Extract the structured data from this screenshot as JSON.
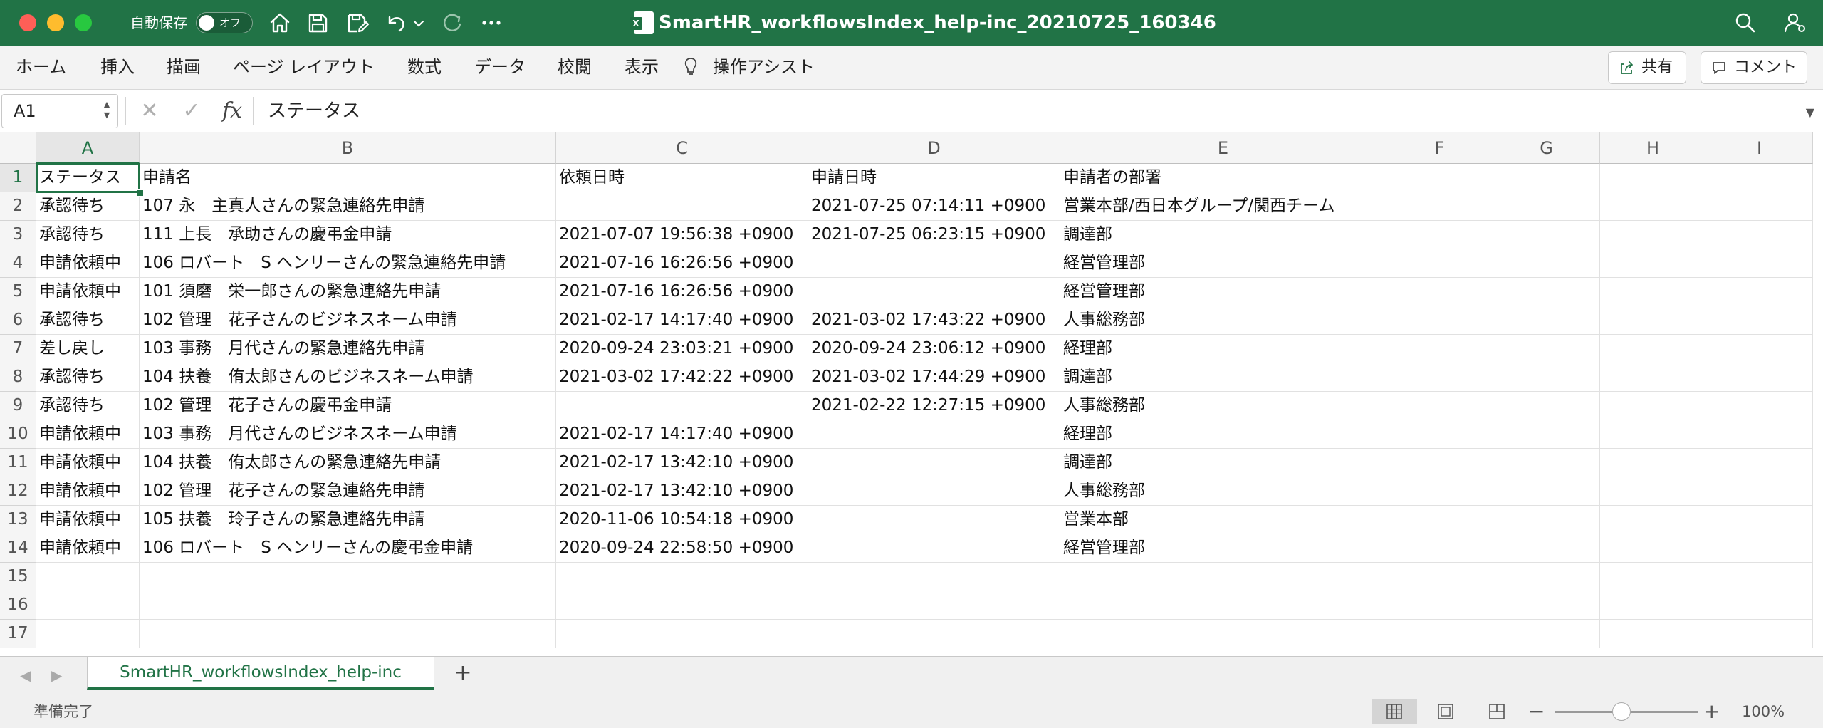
{
  "titlebar": {
    "autosave_label": "自動保存",
    "autosave_state": "オフ",
    "doc_title": "SmartHR_workflowsIndex_help-inc_20210725_160346",
    "accent": "#217346"
  },
  "ribbon": {
    "tabs": [
      "ホーム",
      "挿入",
      "描画",
      "ページ レイアウト",
      "数式",
      "データ",
      "校閲",
      "表示",
      "操作アシスト"
    ],
    "share_label": "共有",
    "comment_label": "コメント"
  },
  "formula_bar": {
    "name_box": "A1",
    "fx": "fx",
    "value": "ステータス"
  },
  "grid": {
    "columns": [
      "A",
      "B",
      "C",
      "D",
      "E",
      "F",
      "G",
      "H",
      "I"
    ],
    "row_numbers": [
      "1",
      "2",
      "3",
      "4",
      "5",
      "6",
      "7",
      "8",
      "9",
      "10",
      "11",
      "12",
      "13",
      "14",
      "15",
      "16",
      "17"
    ],
    "rows": [
      [
        "ステータス",
        "申請名",
        "依頼日時",
        "申請日時",
        "申請者の部署"
      ],
      [
        "承認待ち",
        "107 永　主真人さんの緊急連絡先申請",
        "",
        "2021-07-25 07:14:11 +0900",
        "営業本部/西日本グループ/関西チーム"
      ],
      [
        "承認待ち",
        "111 上長　承助さんの慶弔金申請",
        "2021-07-07 19:56:38 +0900",
        "2021-07-25 06:23:15 +0900",
        "調達部"
      ],
      [
        "申請依頼中",
        "106 ロバート　S ヘンリーさんの緊急連絡先申請",
        "2021-07-16 16:26:56 +0900",
        "",
        "経営管理部"
      ],
      [
        "申請依頼中",
        "101 須磨　栄一郎さんの緊急連絡先申請",
        "2021-07-16 16:26:56 +0900",
        "",
        "経営管理部"
      ],
      [
        "承認待ち",
        "102 管理　花子さんのビジネスネーム申請",
        "2021-02-17 14:17:40 +0900",
        "2021-03-02 17:43:22 +0900",
        "人事総務部"
      ],
      [
        "差し戻し",
        "103 事務　月代さんの緊急連絡先申請",
        "2020-09-24 23:03:21 +0900",
        "2020-09-24 23:06:12 +0900",
        "経理部"
      ],
      [
        "承認待ち",
        "104 扶養　侑太郎さんのビジネスネーム申請",
        "2021-03-02 17:42:22 +0900",
        "2021-03-02 17:44:29 +0900",
        "調達部"
      ],
      [
        "承認待ち",
        "102 管理　花子さんの慶弔金申請",
        "",
        "2021-02-22 12:27:15 +0900",
        "人事総務部"
      ],
      [
        "申請依頼中",
        "103 事務　月代さんのビジネスネーム申請",
        "2021-02-17 14:17:40 +0900",
        "",
        "経理部"
      ],
      [
        "申請依頼中",
        "104 扶養　侑太郎さんの緊急連絡先申請",
        "2021-02-17 13:42:10 +0900",
        "",
        "調達部"
      ],
      [
        "申請依頼中",
        "102 管理　花子さんの緊急連絡先申請",
        "2021-02-17 13:42:10 +0900",
        "",
        "人事総務部"
      ],
      [
        "申請依頼中",
        "105 扶養　玲子さんの緊急連絡先申請",
        "2020-11-06 10:54:18 +0900",
        "",
        "営業本部"
      ],
      [
        "申請依頼中",
        "106 ロバート　S ヘンリーさんの慶弔金申請",
        "2020-09-24 22:58:50 +0900",
        "",
        "経営管理部"
      ]
    ]
  },
  "sheet_tabs": {
    "active": "SmartHR_workflowsIndex_help-inc",
    "add_label": "+"
  },
  "statusbar": {
    "status": "準備完了",
    "zoom": "100%"
  }
}
